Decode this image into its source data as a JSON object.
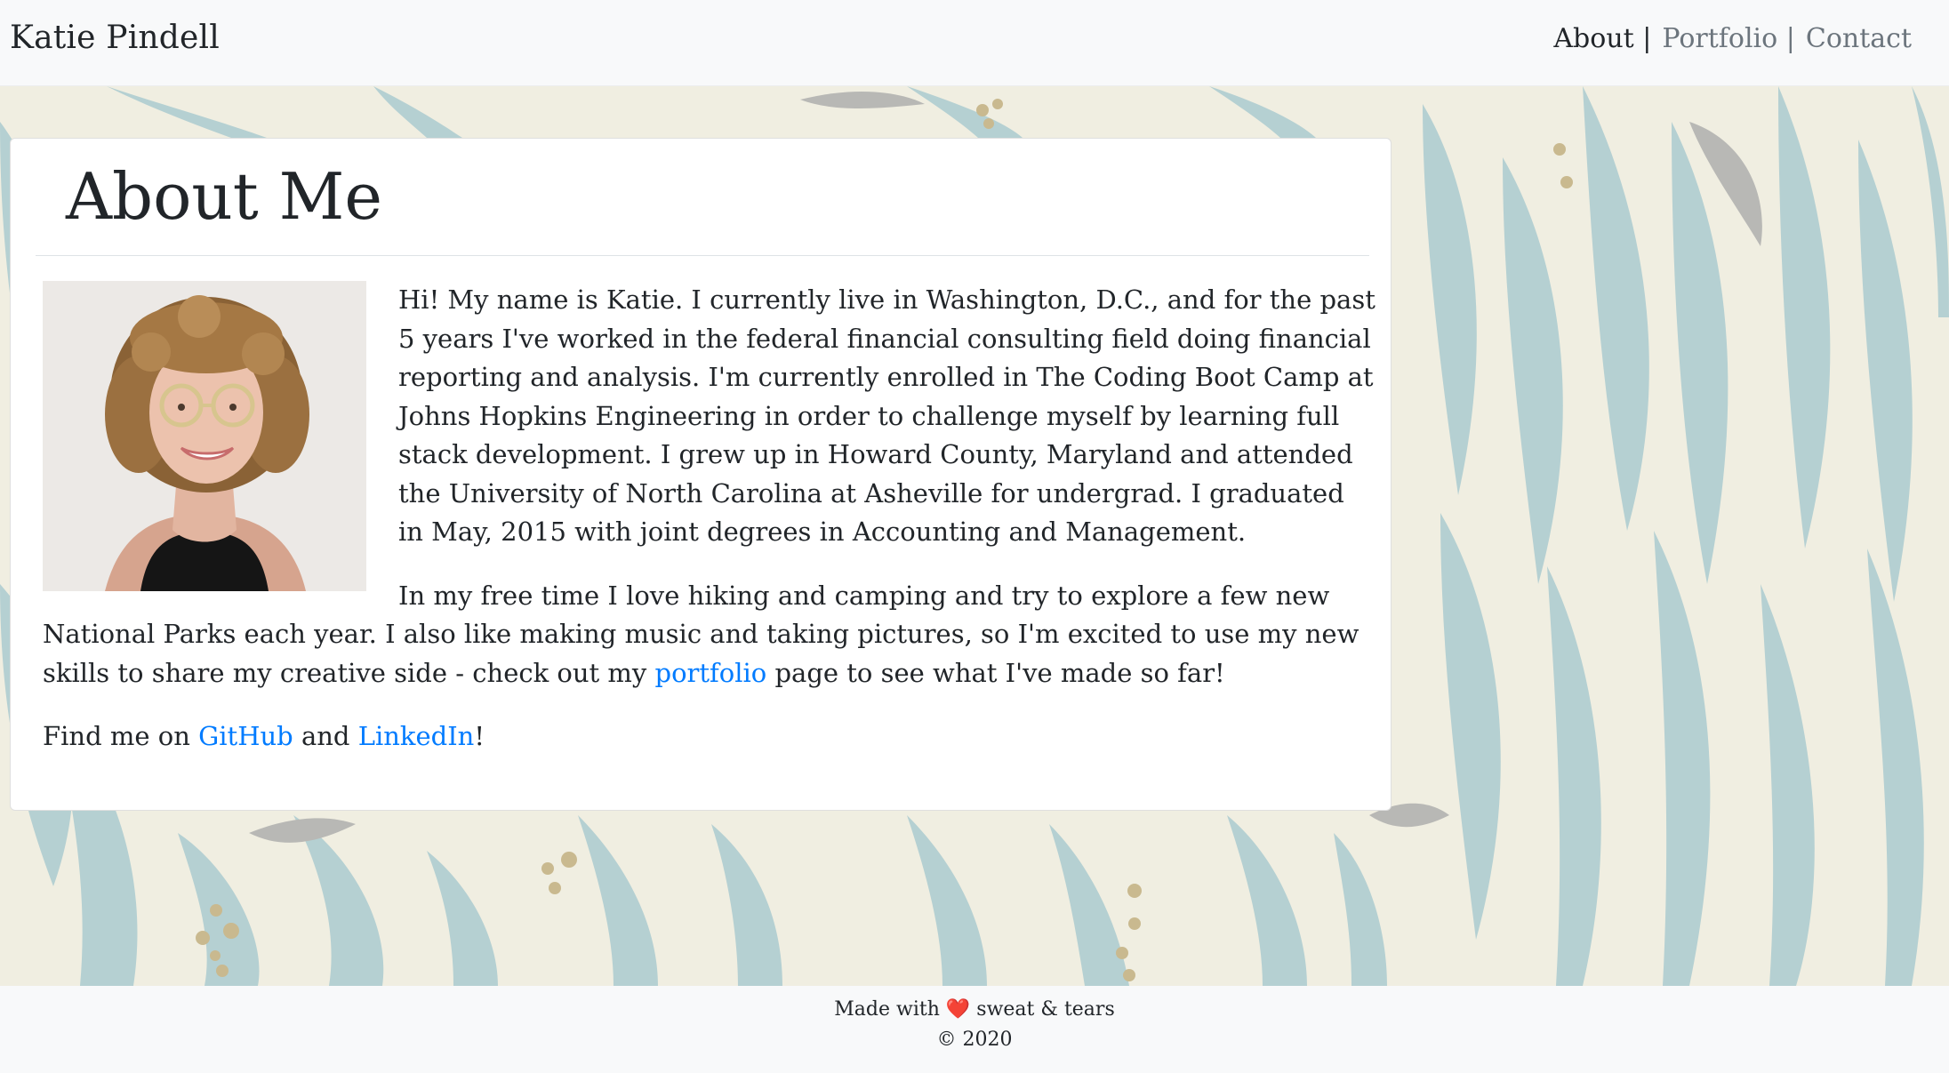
{
  "navbar": {
    "brand": "Katie Pindell",
    "links": [
      {
        "label": "About",
        "separator": "|",
        "active": true
      },
      {
        "label": "Portfolio",
        "separator": "|",
        "active": false
      },
      {
        "label": "Contact",
        "separator": "",
        "active": false
      }
    ]
  },
  "about": {
    "title": "About Me",
    "photo_alt": "Portrait of Katie Pindell",
    "paragraph1": "Hi! My name is Katie. I currently live in Washington, D.C., and for the past 5 years I've worked in the federal financial consulting field doing financial reporting and analysis. I'm currently enrolled in The Coding Boot Camp at Johns Hopkins Engineering in order to challenge myself by learning full stack development. I grew up in Howard County, Maryland and attended the University of North Carolina at Asheville for undergrad. I graduated in May, 2015 with joint degrees in Accounting and Management.",
    "paragraph2_before": "In my free time I love hiking and camping and try to explore a few new National Parks each year. I also like making music and taking pictures, so I'm excited to use my new skills to share my creative side - check out my ",
    "paragraph2_link": "portfolio",
    "paragraph2_after": " page to see what I've made so far!",
    "find_me_prefix": "Find me on ",
    "github_link": "GitHub",
    "find_me_and": " and ",
    "linkedin_link": "LinkedIn",
    "find_me_suffix": "!"
  },
  "footer": {
    "made_with": "Made with",
    "heart": "❤️",
    "sweat_tears": "sweat & tears",
    "copyright": "© 2020"
  },
  "colors": {
    "link": "#007bff",
    "navbar_bg": "#f8f9fa",
    "leaf": "#b5d0d2",
    "background": "#f0eee1"
  },
  "icons": [
    "heart-icon"
  ]
}
